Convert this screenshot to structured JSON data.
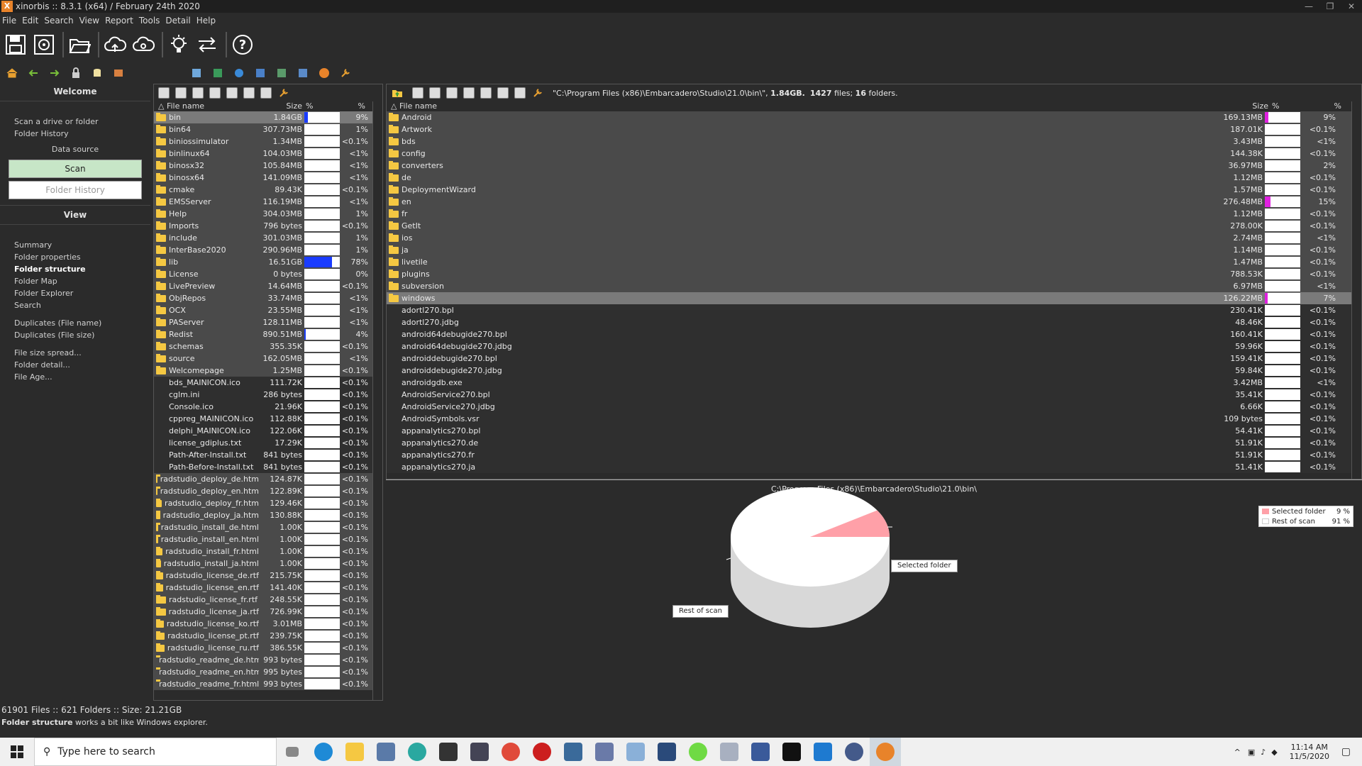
{
  "title": "xinorbis :: 8.3.1 (x64) / February 24th 2020",
  "menu": [
    "File",
    "Edit",
    "Search",
    "View",
    "Report",
    "Tools",
    "Detail",
    "Help"
  ],
  "sidebar": {
    "welcome": "Welcome",
    "scan_link": "Scan a drive or folder",
    "history_link": "Folder History",
    "data_source": "Data source",
    "scan_button": "Scan",
    "history_button": "Folder History",
    "view": "View",
    "views": [
      "Summary",
      "Folder properties",
      "Folder structure",
      "Folder Map",
      "Folder Explorer",
      "Search"
    ],
    "dupes": [
      "Duplicates (File name)",
      "Duplicates (File size)"
    ],
    "more": [
      "File size spread...",
      "Folder detail...",
      "File Age..."
    ]
  },
  "left_pane": {
    "headers": {
      "name": "File name",
      "size": "Size",
      "bar": "%",
      "pct": "%"
    },
    "rows": [
      {
        "name": "bin",
        "size": "1.84GB",
        "pct": "9%",
        "fill": 0.09,
        "type": "sel"
      },
      {
        "name": "bin64",
        "size": "307.73MB",
        "pct": "1%",
        "fill": 0,
        "type": "dir"
      },
      {
        "name": "biniossimulator",
        "size": "1.34MB",
        "pct": "<0.1%",
        "fill": 0,
        "type": "dir"
      },
      {
        "name": "binlinux64",
        "size": "104.03MB",
        "pct": "<1%",
        "fill": 0,
        "type": "dir"
      },
      {
        "name": "binosx32",
        "size": "105.84MB",
        "pct": "<1%",
        "fill": 0,
        "type": "dir"
      },
      {
        "name": "binosx64",
        "size": "141.09MB",
        "pct": "<1%",
        "fill": 0,
        "type": "dir"
      },
      {
        "name": "cmake",
        "size": "89.43K",
        "pct": "<0.1%",
        "fill": 0,
        "type": "dir"
      },
      {
        "name": "EMSServer",
        "size": "116.19MB",
        "pct": "<1%",
        "fill": 0,
        "type": "dir"
      },
      {
        "name": "Help",
        "size": "304.03MB",
        "pct": "1%",
        "fill": 0,
        "type": "dir"
      },
      {
        "name": "Imports",
        "size": "796 bytes",
        "pct": "<0.1%",
        "fill": 0,
        "type": "dir"
      },
      {
        "name": "include",
        "size": "301.03MB",
        "pct": "1%",
        "fill": 0,
        "type": "dir"
      },
      {
        "name": "InterBase2020",
        "size": "290.96MB",
        "pct": "1%",
        "fill": 0,
        "type": "dir"
      },
      {
        "name": "lib",
        "size": "16.51GB",
        "pct": "78%",
        "fill": 0.78,
        "type": "dir"
      },
      {
        "name": "License",
        "size": "0 bytes",
        "pct": "0%",
        "fill": 0,
        "type": "dir"
      },
      {
        "name": "LivePreview",
        "size": "14.64MB",
        "pct": "<0.1%",
        "fill": 0,
        "type": "dir"
      },
      {
        "name": "ObjRepos",
        "size": "33.74MB",
        "pct": "<1%",
        "fill": 0,
        "type": "dir"
      },
      {
        "name": "OCX",
        "size": "23.55MB",
        "pct": "<1%",
        "fill": 0,
        "type": "dir"
      },
      {
        "name": "PAServer",
        "size": "128.11MB",
        "pct": "<1%",
        "fill": 0,
        "type": "dir"
      },
      {
        "name": "Redist",
        "size": "890.51MB",
        "pct": "4%",
        "fill": 0.04,
        "type": "dir"
      },
      {
        "name": "schemas",
        "size": "355.35K",
        "pct": "<0.1%",
        "fill": 0,
        "type": "dir"
      },
      {
        "name": "source",
        "size": "162.05MB",
        "pct": "<1%",
        "fill": 0,
        "type": "dir"
      },
      {
        "name": "Welcomepage",
        "size": "1.25MB",
        "pct": "<0.1%",
        "fill": 0,
        "type": "dir"
      },
      {
        "name": "bds_MAINICON.ico",
        "size": "111.72K",
        "pct": "<0.1%",
        "fill": 0,
        "type": "file"
      },
      {
        "name": "cglm.ini",
        "size": "286 bytes",
        "pct": "<0.1%",
        "fill": 0,
        "type": "file"
      },
      {
        "name": "Console.ico",
        "size": "21.96K",
        "pct": "<0.1%",
        "fill": 0,
        "type": "file"
      },
      {
        "name": "cppreg_MAINICON.ico",
        "size": "112.88K",
        "pct": "<0.1%",
        "fill": 0,
        "type": "file"
      },
      {
        "name": "delphi_MAINICON.ico",
        "size": "122.06K",
        "pct": "<0.1%",
        "fill": 0,
        "type": "file"
      },
      {
        "name": "license_gdiplus.txt",
        "size": "17.29K",
        "pct": "<0.1%",
        "fill": 0,
        "type": "file"
      },
      {
        "name": "Path-After-Install.txt",
        "size": "841 bytes",
        "pct": "<0.1%",
        "fill": 0,
        "type": "file"
      },
      {
        "name": "Path-Before-Install.txt",
        "size": "841 bytes",
        "pct": "<0.1%",
        "fill": 0,
        "type": "file"
      },
      {
        "name": "radstudio_deploy_de.htm",
        "size": "124.87K",
        "pct": "<0.1%",
        "fill": 0,
        "type": "dir"
      },
      {
        "name": "radstudio_deploy_en.htm",
        "size": "122.89K",
        "pct": "<0.1%",
        "fill": 0,
        "type": "dir"
      },
      {
        "name": "radstudio_deploy_fr.htm",
        "size": "129.46K",
        "pct": "<0.1%",
        "fill": 0,
        "type": "dir"
      },
      {
        "name": "radstudio_deploy_ja.htm",
        "size": "130.88K",
        "pct": "<0.1%",
        "fill": 0,
        "type": "dir"
      },
      {
        "name": "radstudio_install_de.html",
        "size": "1.00K",
        "pct": "<0.1%",
        "fill": 0,
        "type": "dir"
      },
      {
        "name": "radstudio_install_en.html",
        "size": "1.00K",
        "pct": "<0.1%",
        "fill": 0,
        "type": "dir"
      },
      {
        "name": "radstudio_install_fr.html",
        "size": "1.00K",
        "pct": "<0.1%",
        "fill": 0,
        "type": "dir"
      },
      {
        "name": "radstudio_install_ja.html",
        "size": "1.00K",
        "pct": "<0.1%",
        "fill": 0,
        "type": "dir"
      },
      {
        "name": "radstudio_license_de.rtf",
        "size": "215.75K",
        "pct": "<0.1%",
        "fill": 0,
        "type": "dir"
      },
      {
        "name": "radstudio_license_en.rtf",
        "size": "141.40K",
        "pct": "<0.1%",
        "fill": 0,
        "type": "dir"
      },
      {
        "name": "radstudio_license_fr.rtf",
        "size": "248.55K",
        "pct": "<0.1%",
        "fill": 0,
        "type": "dir"
      },
      {
        "name": "radstudio_license_ja.rtf",
        "size": "726.99K",
        "pct": "<0.1%",
        "fill": 0,
        "type": "dir"
      },
      {
        "name": "radstudio_license_ko.rtf",
        "size": "3.01MB",
        "pct": "<0.1%",
        "fill": 0,
        "type": "dir"
      },
      {
        "name": "radstudio_license_pt.rtf",
        "size": "239.75K",
        "pct": "<0.1%",
        "fill": 0,
        "type": "dir"
      },
      {
        "name": "radstudio_license_ru.rtf",
        "size": "386.55K",
        "pct": "<0.1%",
        "fill": 0,
        "type": "dir"
      },
      {
        "name": "radstudio_readme_de.htm",
        "size": "993 bytes",
        "pct": "<0.1%",
        "fill": 0,
        "type": "dir"
      },
      {
        "name": "radstudio_readme_en.htm",
        "size": "995 bytes",
        "pct": "<0.1%",
        "fill": 0,
        "type": "dir"
      },
      {
        "name": "radstudio_readme_fr.html",
        "size": "993 bytes",
        "pct": "<0.1%",
        "fill": 0,
        "type": "dir"
      }
    ]
  },
  "right_pane": {
    "path_info": "\"C:\\Program Files (x86)\\Embarcadero\\Studio\\21.0\\bin\\\", ",
    "size_info": "1.84GB.",
    "files_count": "1427",
    "files_label": " files; ",
    "folders_count": "16",
    "folders_label": " folders.",
    "headers": {
      "name": "File name",
      "size": "Size",
      "bar": "%",
      "pct": "%"
    },
    "rows": [
      {
        "name": "Android",
        "size": "169.13MB",
        "pct": "9%",
        "fill": 0.09,
        "type": "dir"
      },
      {
        "name": "Artwork",
        "size": "187.01K",
        "pct": "<0.1%",
        "fill": 0,
        "type": "dir"
      },
      {
        "name": "bds",
        "size": "3.43MB",
        "pct": "<1%",
        "fill": 0,
        "type": "dir"
      },
      {
        "name": "config",
        "size": "144.38K",
        "pct": "<0.1%",
        "fill": 0,
        "type": "dir"
      },
      {
        "name": "converters",
        "size": "36.97MB",
        "pct": "2%",
        "fill": 0,
        "type": "dir"
      },
      {
        "name": "de",
        "size": "1.12MB",
        "pct": "<0.1%",
        "fill": 0,
        "type": "dir"
      },
      {
        "name": "DeploymentWizard",
        "size": "1.57MB",
        "pct": "<0.1%",
        "fill": 0,
        "type": "dir"
      },
      {
        "name": "en",
        "size": "276.48MB",
        "pct": "15%",
        "fill": 0.15,
        "type": "dir"
      },
      {
        "name": "fr",
        "size": "1.12MB",
        "pct": "<0.1%",
        "fill": 0,
        "type": "dir"
      },
      {
        "name": "GetIt",
        "size": "278.00K",
        "pct": "<0.1%",
        "fill": 0,
        "type": "dir"
      },
      {
        "name": "ios",
        "size": "2.74MB",
        "pct": "<1%",
        "fill": 0,
        "type": "dir"
      },
      {
        "name": "ja",
        "size": "1.14MB",
        "pct": "<0.1%",
        "fill": 0,
        "type": "dir"
      },
      {
        "name": "livetile",
        "size": "1.47MB",
        "pct": "<0.1%",
        "fill": 0,
        "type": "dir"
      },
      {
        "name": "plugins",
        "size": "788.53K",
        "pct": "<0.1%",
        "fill": 0,
        "type": "dir"
      },
      {
        "name": "subversion",
        "size": "6.97MB",
        "pct": "<1%",
        "fill": 0,
        "type": "dir"
      },
      {
        "name": "windows",
        "size": "126.22MB",
        "pct": "7%",
        "fill": 0.07,
        "type": "sel"
      },
      {
        "name": "adortl270.bpl",
        "size": "230.41K",
        "pct": "<0.1%",
        "fill": 0,
        "type": "file"
      },
      {
        "name": "adortl270.jdbg",
        "size": "48.46K",
        "pct": "<0.1%",
        "fill": 0,
        "type": "file"
      },
      {
        "name": "android64debugide270.bpl",
        "size": "160.41K",
        "pct": "<0.1%",
        "fill": 0,
        "type": "file"
      },
      {
        "name": "android64debugide270.jdbg",
        "size": "59.96K",
        "pct": "<0.1%",
        "fill": 0,
        "type": "file"
      },
      {
        "name": "androiddebugide270.bpl",
        "size": "159.41K",
        "pct": "<0.1%",
        "fill": 0,
        "type": "file"
      },
      {
        "name": "androiddebugide270.jdbg",
        "size": "59.84K",
        "pct": "<0.1%",
        "fill": 0,
        "type": "file"
      },
      {
        "name": "androidgdb.exe",
        "size": "3.42MB",
        "pct": "<1%",
        "fill": 0,
        "type": "file"
      },
      {
        "name": "AndroidService270.bpl",
        "size": "35.41K",
        "pct": "<0.1%",
        "fill": 0,
        "type": "file"
      },
      {
        "name": "AndroidService270.jdbg",
        "size": "6.66K",
        "pct": "<0.1%",
        "fill": 0,
        "type": "file"
      },
      {
        "name": "AndroidSymbols.vsr",
        "size": "109 bytes",
        "pct": "<0.1%",
        "fill": 0,
        "type": "file"
      },
      {
        "name": "appanalytics270.bpl",
        "size": "54.41K",
        "pct": "<0.1%",
        "fill": 0,
        "type": "file"
      },
      {
        "name": "appanalytics270.de",
        "size": "51.91K",
        "pct": "<0.1%",
        "fill": 0,
        "type": "file"
      },
      {
        "name": "appanalytics270.fr",
        "size": "51.91K",
        "pct": "<0.1%",
        "fill": 0,
        "type": "file"
      },
      {
        "name": "appanalytics270.ja",
        "size": "51.41K",
        "pct": "<0.1%",
        "fill": 0,
        "type": "file"
      }
    ]
  },
  "pie": {
    "title": "C:\\Program Files (x86)\\Embarcadero\\Studio\\21.0\\bin\\",
    "legend": [
      {
        "label": "Selected folder",
        "pct": "9 %",
        "color": "#ffa0a8"
      },
      {
        "label": "Rest of scan",
        "pct": "91 %",
        "color": "#ffffff"
      }
    ],
    "callout_selected": "Selected folder",
    "callout_rest": "Rest of scan",
    "selected_fraction": 0.09
  },
  "status": {
    "files_count": "61901",
    "files_label": " Files :: ",
    "folders_count": "621",
    "folders_label": " Folders :: Size: ",
    "size": "21.21GB",
    "hint_bold": "Folder structure",
    "hint_rest": " works a bit like Windows explorer."
  },
  "taskbar": {
    "search_placeholder": "Type here to search",
    "time": "11:14 AM",
    "date": "11/5/2020"
  },
  "colors": {
    "bar_blue": "#1a3cff",
    "bar_magenta": "#e020e0",
    "folder": "#f5c842",
    "scan_green": "#c7e6c7"
  }
}
